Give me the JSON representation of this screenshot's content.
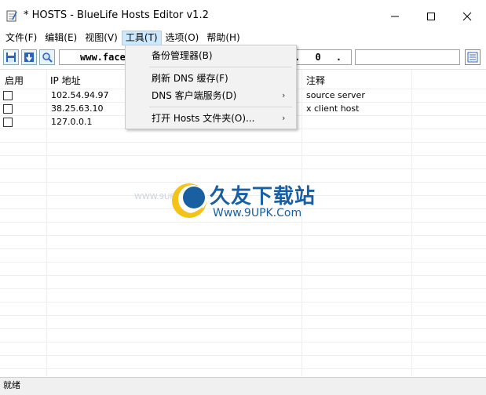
{
  "window": {
    "title": "* HOSTS - BlueLife Hosts Editor v1.2"
  },
  "menubar": {
    "items": [
      "文件(F)",
      "编辑(E)",
      "视图(V)",
      "工具(T)",
      "选项(O)",
      "帮助(H)"
    ],
    "active": "工具(T)"
  },
  "toolbar": {
    "host_field": "www.facel",
    "ip_field": ". 0 . 1",
    "comment_field": ""
  },
  "table": {
    "columns": [
      "启用",
      "IP 地址",
      "注释"
    ],
    "rows": [
      {
        "enabled": false,
        "ip": "102.54.94.97",
        "comment": "source server"
      },
      {
        "enabled": false,
        "ip": "38.25.63.10",
        "comment": "x client host"
      },
      {
        "enabled": false,
        "ip": "127.0.0.1",
        "comment": ""
      }
    ]
  },
  "tools_menu": {
    "items": [
      {
        "label": "备份管理器(B)",
        "has_submenu": false
      },
      {
        "label": "刷新 DNS 缓存(F)",
        "has_submenu": false
      },
      {
        "label": "DNS 客户端服务(D)",
        "has_submenu": true
      },
      {
        "label": "打开 Hosts 文件夹(O)...",
        "has_submenu": true
      }
    ]
  },
  "watermark": {
    "brand": "久友下载站",
    "url": "Www.9UPK.Com",
    "faint": "WWW.9UPK.COM"
  },
  "statusbar": {
    "text": "就绪"
  },
  "colors": {
    "accent": "#1a5fa0",
    "menu_highlight": "#cce8ff"
  }
}
